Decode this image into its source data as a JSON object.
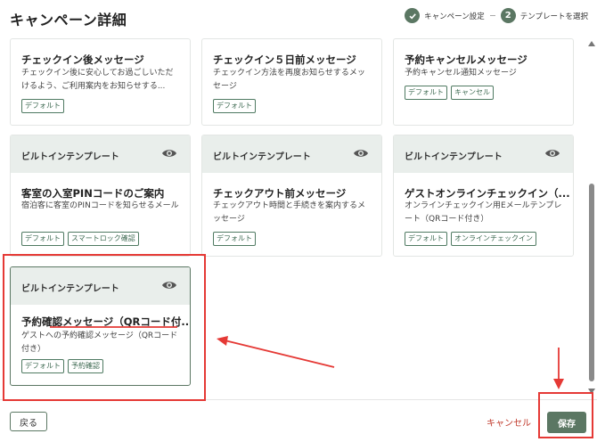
{
  "dialog": {
    "title": "キャンペーン詳細"
  },
  "steps": [
    {
      "label": "キャンペーン設定",
      "state": "done"
    },
    {
      "number": "2",
      "label": "テンプレートを選択",
      "state": "current"
    }
  ],
  "cards": [
    {
      "title": "チェックイン後メッセージ",
      "desc": "チェックイン後に安心してお過ごしいただけるよう、ご利用案内をお知らせする...",
      "tags": [
        "デフォルト"
      ]
    },
    {
      "title": "チェックイン５日前メッセージ",
      "desc": "チェックイン方法を再度お知らせするメッセージ",
      "tags": [
        "デフォルト"
      ]
    },
    {
      "title": "予約キャンセルメッセージ",
      "desc": "予約キャンセル通知メッセージ",
      "tags": [
        "デフォルト",
        "キャンセル"
      ]
    },
    {
      "header": "ビルトインテンプレート",
      "title": "客室の入室PINコードのご案内",
      "desc": "宿泊客に客室のPINコードを知らせるメール",
      "tags": [
        "デフォルト",
        "スマートロック確認"
      ]
    },
    {
      "header": "ビルトインテンプレート",
      "title": "チェックアウト前メッセージ",
      "desc": "チェックアウト時間と手続きを案内するメッセージ",
      "tags": [
        "デフォルト"
      ]
    },
    {
      "header": "ビルトインテンプレート",
      "title": "ゲストオンラインチェックイン（...",
      "desc": "オンラインチェックイン用Eメールテンプレート（QRコード付き）",
      "tags": [
        "デフォルト",
        "オンラインチェックイン"
      ]
    },
    {
      "header": "ビルトインテンプレート",
      "title": "予約確認メッセージ（QRコード付...",
      "desc": "ゲストへの予約確認メッセージ（QRコード付き）",
      "tags": [
        "デフォルト",
        "予約確認"
      ]
    }
  ],
  "footer": {
    "back_label": "戻る",
    "cancel_label": "キャンセル",
    "save_label": "保存"
  },
  "icons": {
    "step_done": "check-circle-icon",
    "preview": "eye-icon"
  },
  "colors": {
    "accent": "#5b7763",
    "annotation": "#e53935",
    "cancel": "#c0392b"
  }
}
